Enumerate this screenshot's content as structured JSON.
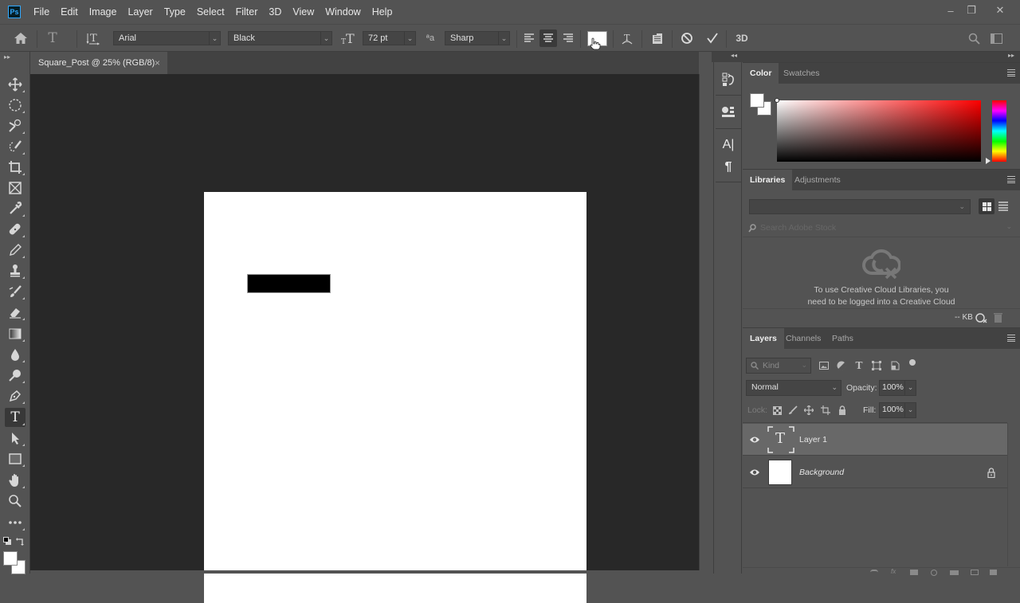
{
  "app": {
    "logo_text": "Ps",
    "menu": [
      "File",
      "Edit",
      "Image",
      "Layer",
      "Type",
      "Select",
      "Filter",
      "3D",
      "View",
      "Window",
      "Help"
    ],
    "window_controls": {
      "minimize": "–",
      "restore": "❐",
      "close": "✕"
    }
  },
  "options_bar": {
    "font_family": "Arial",
    "font_style": "Black",
    "font_size": "72 pt",
    "anti_alias": "Sharp",
    "alignment_selected": "center",
    "text_color": "#ffffff",
    "three_d_label": "3D"
  },
  "document": {
    "tab_title": "Square_Post @ 25% (RGB/8)",
    "close_glyph": "×",
    "zoom_percent": 25,
    "color_mode": "RGB/8",
    "canvas_color": "#ffffff",
    "text_box_color": "#000000"
  },
  "tools": [
    "move",
    "elliptical-marquee",
    "quick-selection",
    "lasso",
    "crop",
    "frame",
    "eyedropper",
    "healing-brush",
    "brush",
    "clone-stamp",
    "history-brush",
    "eraser",
    "gradient",
    "blur",
    "dodge",
    "pen",
    "type",
    "path-selection",
    "rectangle",
    "hand",
    "zoom",
    "more"
  ],
  "active_tool": "type",
  "swatches": {
    "foreground": "#ffffff",
    "background": "#ffffff"
  },
  "color_panel": {
    "tabs": [
      "Color",
      "Swatches"
    ],
    "active_tab": "Color",
    "foreground": "#ffffff",
    "background": "#ffffff",
    "hue": "#ff0000"
  },
  "libraries_panel": {
    "tabs": [
      "Libraries",
      "Adjustments"
    ],
    "active_tab": "Libraries",
    "library_select_value": "",
    "search_placeholder": "Search Adobe Stock",
    "message_line1": "To use Creative Cloud Libraries, you",
    "message_line2": "need to be logged into a Creative Cloud",
    "storage": "-- KB"
  },
  "layers_panel": {
    "tabs": [
      "Layers",
      "Channels",
      "Paths"
    ],
    "active_tab": "Layers",
    "filter_placeholder": "Kind",
    "blend_mode": "Normal",
    "opacity_label": "Opacity:",
    "opacity_value": "100%",
    "lock_label": "Lock:",
    "fill_label": "Fill:",
    "fill_value": "100%",
    "layers": [
      {
        "name": "Layer 1",
        "type": "text",
        "visible": true,
        "selected": true,
        "locked": false,
        "thumb_glyph": "T"
      },
      {
        "name": "Background",
        "type": "background",
        "visible": true,
        "selected": false,
        "locked": true
      }
    ]
  }
}
